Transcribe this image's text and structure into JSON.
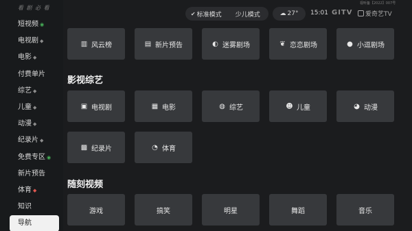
{
  "sidebar": {
    "logo_text": "看 剧 必 看",
    "items": [
      {
        "label": "短视频",
        "mark": "◉",
        "mark_color": "green"
      },
      {
        "label": "电视剧",
        "mark": "◆",
        "mark_color": "grey"
      },
      {
        "label": "电影",
        "mark": "◆",
        "mark_color": "grey"
      },
      {
        "label": "付费单片",
        "mark": "",
        "mark_color": "grey"
      },
      {
        "label": "综艺",
        "mark": "◆",
        "mark_color": "grey"
      },
      {
        "label": "儿童",
        "mark": "◆",
        "mark_color": "grey"
      },
      {
        "label": "动漫",
        "mark": "◆",
        "mark_color": "grey"
      },
      {
        "label": "纪录片",
        "mark": "◆",
        "mark_color": "grey"
      },
      {
        "label": "免费专区",
        "mark": "◉",
        "mark_color": "green"
      },
      {
        "label": "新片预告",
        "mark": "",
        "mark_color": "grey"
      },
      {
        "label": "体育",
        "mark": "◆",
        "mark_color": "red"
      },
      {
        "label": "知识",
        "mark": "",
        "mark_color": "grey"
      },
      {
        "label": "导航",
        "mark": "",
        "mark_color": "grey",
        "active": true
      }
    ]
  },
  "topbar": {
    "mode_standard": "标准模式",
    "mode_kids": "少儿模式",
    "weather_temp": "27°",
    "time": "15:01",
    "brand_primary": "GITV",
    "brand_secondary": "爱奇艺TV",
    "license_text": "视听备【2022】007号"
  },
  "top_row": [
    {
      "label": "风云榜",
      "icon": "bar-chart-icon",
      "glyph": "▥"
    },
    {
      "label": "新片预告",
      "icon": "film-book-icon",
      "glyph": "▤"
    },
    {
      "label": "迷雾剧场",
      "icon": "magnifier-icon",
      "glyph": "◐"
    },
    {
      "label": "恋恋剧场",
      "icon": "leaf-icon",
      "glyph": "❦"
    },
    {
      "label": "小逗剧场",
      "icon": "bubble-icon",
      "glyph": "●"
    }
  ],
  "section_variety": {
    "title": "影视综艺",
    "items": [
      {
        "label": "电视剧",
        "icon": "tv-icon",
        "glyph": "▣"
      },
      {
        "label": "电影",
        "icon": "movie-icon",
        "glyph": "▦"
      },
      {
        "label": "综艺",
        "icon": "microphone-icon",
        "glyph": "◍"
      },
      {
        "label": "儿童",
        "icon": "child-face-icon",
        "glyph": "☻"
      },
      {
        "label": "动漫",
        "icon": "bear-face-icon",
        "glyph": "◕"
      },
      {
        "label": "纪录片",
        "icon": "filmstrip-icon",
        "glyph": "▩"
      },
      {
        "label": "体育",
        "icon": "ball-icon",
        "glyph": "◔"
      }
    ]
  },
  "section_short": {
    "title": "随刻视频",
    "items": [
      "游戏",
      "搞笑",
      "明星",
      "舞蹈",
      "音乐"
    ]
  },
  "colors": {
    "background": "#1b1c1e",
    "tile": "#37393c",
    "active_nav": "#f1f1f1"
  }
}
